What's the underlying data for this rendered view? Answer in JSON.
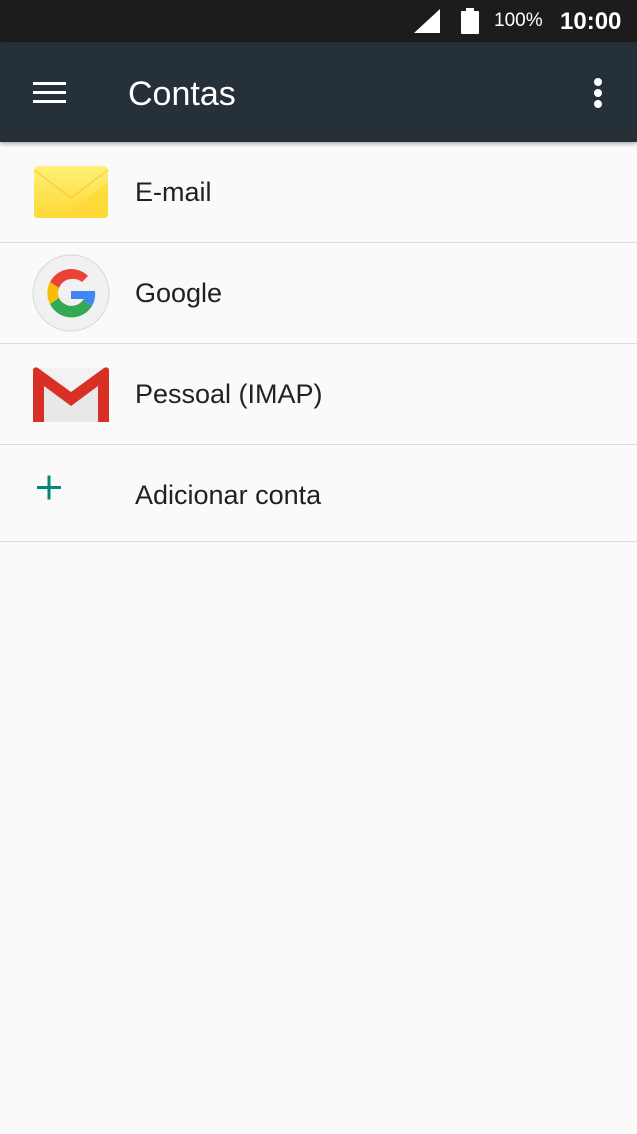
{
  "status_bar": {
    "battery_percent": "100%",
    "time": "10:00",
    "icons": [
      "signal-icon",
      "battery-icon"
    ]
  },
  "app_bar": {
    "title": "Contas",
    "icons": [
      "menu-icon",
      "more-options-icon"
    ]
  },
  "accounts": [
    {
      "label": "E-mail",
      "icon": "email-app-icon"
    },
    {
      "label": "Google",
      "icon": "google-icon"
    },
    {
      "label": "Pessoal (IMAP)",
      "icon": "gmail-icon"
    }
  ],
  "add_account": {
    "label": "Adicionar conta",
    "icon": "plus-icon"
  },
  "colors": {
    "status_bar": "#1c1c1c",
    "app_bar": "#263039",
    "background": "#fafafa",
    "accent_teal": "#00897b"
  }
}
